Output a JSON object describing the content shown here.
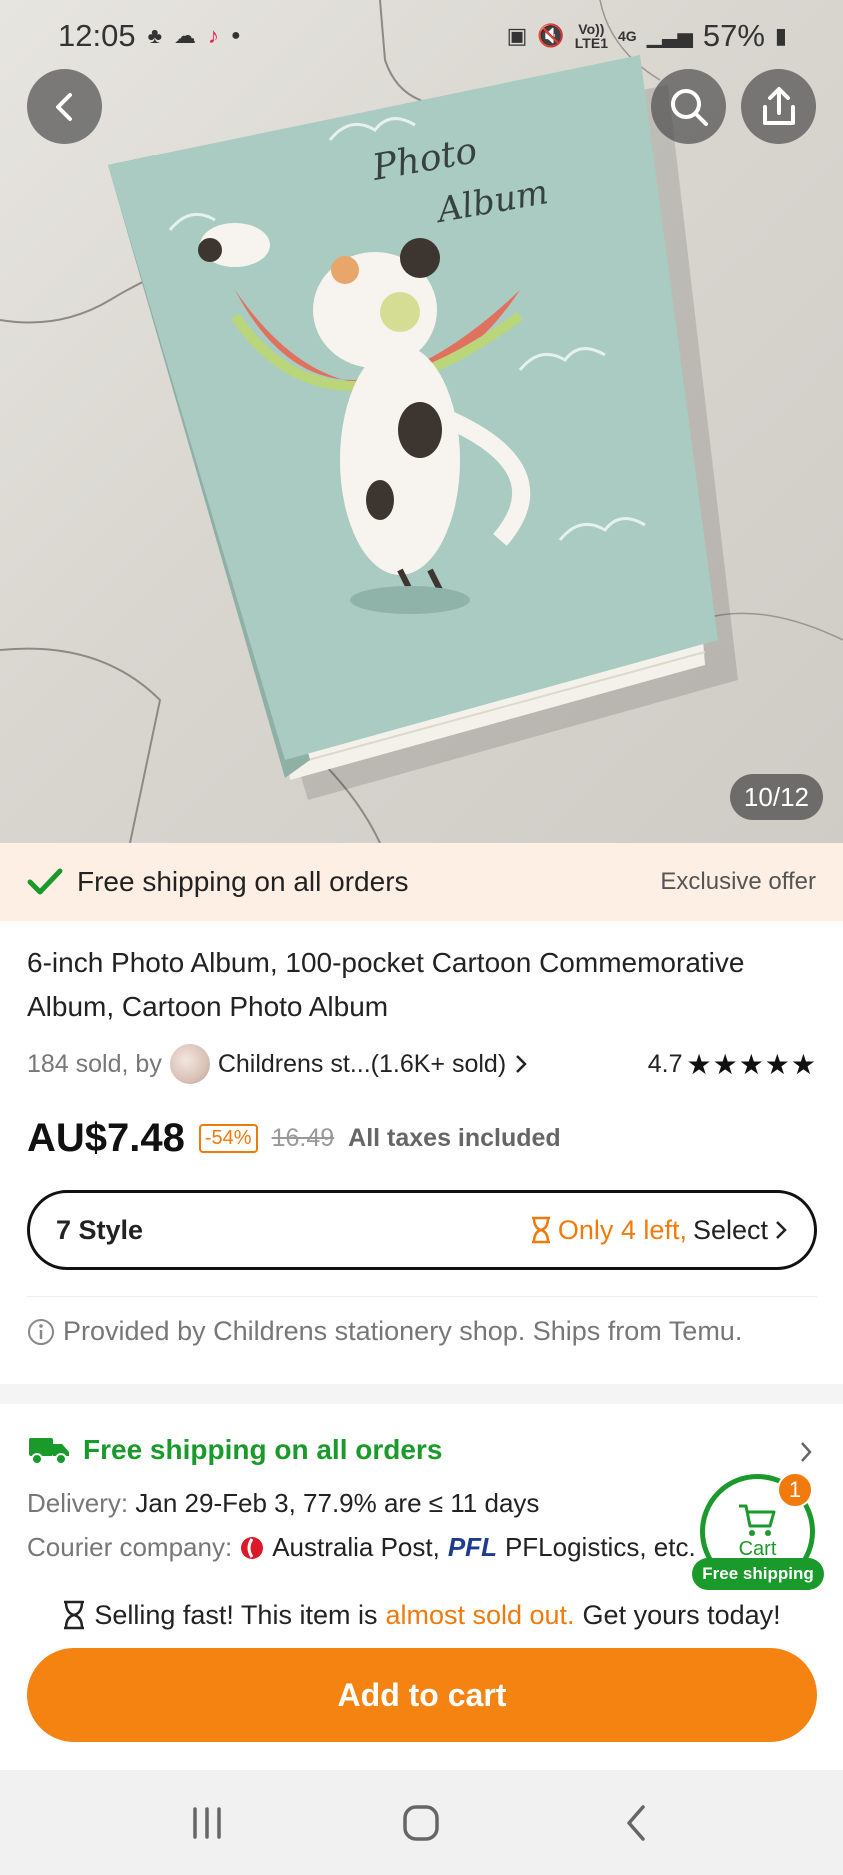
{
  "status_bar": {
    "time": "12:05",
    "network_top": "Vo))",
    "network_bottom": "LTE1",
    "gen": "4G",
    "battery": "57%"
  },
  "hero": {
    "image_counter": "10/12",
    "book_title_line1": "Photo",
    "book_title_line2": "Album"
  },
  "ship_banner": {
    "text": "Free shipping on all orders",
    "offer": "Exclusive offer"
  },
  "product": {
    "title": "6-inch Photo Album, 100-pocket Cartoon Commemorative Album, Cartoon Photo Album",
    "sold_by": "184 sold, by",
    "store": "Childrens st...(1.6K+ sold)",
    "rating": "4.7",
    "stars": "★★★★★",
    "price": "AU$7.48",
    "discount": "-54%",
    "old_price": "16.49",
    "tax_note": "All taxes included"
  },
  "style_selector": {
    "label": "7 Style",
    "stock": "Only 4 left,",
    "select": "Select"
  },
  "provided_by": "Provided by Childrens stationery shop. Ships from Temu.",
  "shipping": {
    "title": "Free shipping on all orders",
    "delivery_label": "Delivery:",
    "delivery_value": "Jan 29-Feb 3, 77.9% are ≤ 11 days",
    "courier_label": "Courier company:",
    "courier_1": "Australia Post,",
    "courier_2_logo": "PFL",
    "courier_2": "PFLogistics, etc."
  },
  "cart": {
    "label": "Cart",
    "badge": "1",
    "free_ship": "Free shipping"
  },
  "selling": {
    "pre": "Selling fast! This item is",
    "highlight": "almost sold out.",
    "post": "Get yours today!"
  },
  "add_to_cart": "Add to cart",
  "colors": {
    "accent": "#f58312",
    "green": "#1a9a2b",
    "banner_bg": "#fdefe4"
  }
}
